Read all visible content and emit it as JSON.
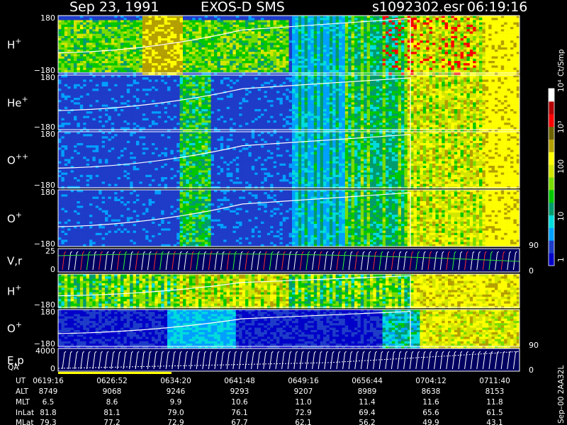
{
  "header": {
    "date": "Sep 23, 1991",
    "mission": "EXOS-D SMS",
    "file": "s1092302.esr",
    "time": "06:19:16"
  },
  "colorbar": {
    "unit": "Ct/Smp",
    "labels": [
      "1",
      "10",
      "100",
      "10³",
      "10⁴"
    ],
    "colors": [
      "#000080",
      "#0000c8",
      "#1e3cc8",
      "#00a0ff",
      "#00dcdc",
      "#009c6e",
      "#00c800",
      "#78dc00",
      "#d2e600",
      "#ffff00",
      "#b4a000",
      "#6e6400",
      "#ff0000",
      "#b40000",
      "#ffffff"
    ]
  },
  "panels": [
    {
      "key": "H+",
      "label": "H",
      "sup": "+",
      "ymax": "180",
      "ymin": "−180",
      "right_label": ""
    },
    {
      "key": "He+",
      "label": "He",
      "sup": "+",
      "ymax": "180",
      "ymin": "−180",
      "right_label": ""
    },
    {
      "key": "O++",
      "label": "O",
      "sup": "++",
      "ymax": "180",
      "ymin": "−180",
      "right_label": ""
    },
    {
      "key": "O+",
      "label": "O",
      "sup": "+",
      "ymax": "180",
      "ymin": "−180",
      "right_label": "90"
    },
    {
      "key": "Vr",
      "label": "V,r",
      "sup": "",
      "ymax": "25",
      "ymin": "0",
      "right_label": "0"
    },
    {
      "key": "H+2",
      "label": "H",
      "sup": "+",
      "ymax": "",
      "ymin": "−180",
      "right_label": ""
    },
    {
      "key": "O+2",
      "label": "O",
      "sup": "+",
      "ymax": "180",
      "ymin": "−180",
      "right_label": "90"
    },
    {
      "key": "Ep",
      "label": "E,p",
      "sup": "",
      "ymax": "4000",
      "ymin": "0",
      "right_label": "0"
    }
  ],
  "qa_label": "QA",
  "side_note": "Sep–00  2AA32L",
  "chart_data": {
    "type": "heatmap",
    "title": "Sep 23, 1991   EXOS-D SMS",
    "xlabel": "UT",
    "ylabel": "",
    "rows": [
      "UT",
      "ALT",
      "MLT",
      "InLat",
      "MLat"
    ],
    "ut": [
      "0619:16",
      "0626:52",
      "0634:20",
      "0641:48",
      "0649:16",
      "0656:44",
      "0704:12",
      "0711:40"
    ],
    "alt": [
      8749,
      9068,
      9246,
      9293,
      9207,
      8989,
      8638,
      8153
    ],
    "mlt": [
      "6.5",
      "8.6",
      "9.9",
      "10.6",
      "11.0",
      "11.4",
      "11.6",
      "11.8"
    ],
    "inlat": [
      "81.8",
      "81.1",
      "79.0",
      "76.1",
      "72.9",
      "69.4",
      "65.6",
      "61.5"
    ],
    "mlat": [
      "79.3",
      "77.2",
      "72.9",
      "67.7",
      "62.1",
      "56.2",
      "49.9",
      "43.1"
    ],
    "color_scale": "log",
    "color_range": [
      1,
      10000
    ],
    "color_unit": "Ct/Smp"
  }
}
